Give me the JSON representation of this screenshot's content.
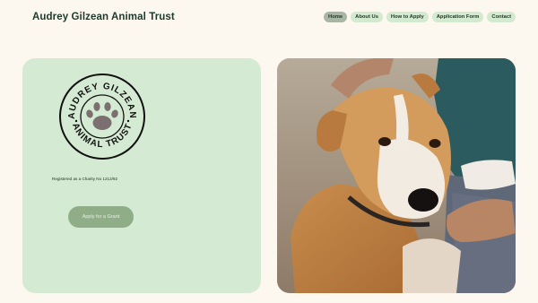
{
  "site": {
    "title": "Audrey Gilzean Animal Trust"
  },
  "nav": {
    "items": [
      {
        "label": "Home",
        "active": true
      },
      {
        "label": "About Us",
        "active": false
      },
      {
        "label": "How to Apply",
        "active": false
      },
      {
        "label": "Application Form",
        "active": false
      },
      {
        "label": "Contact",
        "active": false
      }
    ]
  },
  "logo": {
    "top_text": "AUDREY GILZEAN",
    "bottom_text": "ANIMAL TRUST",
    "icon": "paw-icon"
  },
  "hero": {
    "charity_number": "Registered as a Charity No 1212/92",
    "cta_label": "Apply for a Grant"
  },
  "photo": {
    "subject": "dog-photo"
  },
  "colors": {
    "background": "#fcf7ef",
    "card": "#d5ead3",
    "nav_pill": "#d4ead0",
    "nav_active": "#a9b6a6",
    "button": "#8fae87",
    "text_dark": "#1d3a2b",
    "paw": "#7c6f6f"
  }
}
